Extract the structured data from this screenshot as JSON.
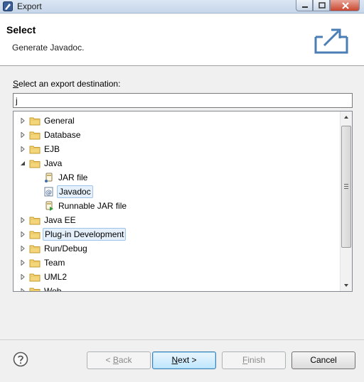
{
  "window": {
    "title": "Export",
    "icon": "eclipse-icon"
  },
  "header": {
    "title": "Select",
    "description": "Generate Javadoc.",
    "icon": "export-icon"
  },
  "destination": {
    "label_mnemonic": "S",
    "label_rest": "elect an export destination:",
    "filter_value": "j"
  },
  "tree": {
    "items": [
      {
        "label": "General",
        "level": 0,
        "type": "folder",
        "expanded": false
      },
      {
        "label": "Database",
        "level": 0,
        "type": "folder",
        "expanded": false
      },
      {
        "label": "EJB",
        "level": 0,
        "type": "folder",
        "expanded": false
      },
      {
        "label": "Java",
        "level": 0,
        "type": "folder",
        "expanded": true
      },
      {
        "label": "JAR file",
        "level": 1,
        "type": "jar",
        "expanded": null
      },
      {
        "label": "Javadoc",
        "level": 1,
        "type": "javadoc",
        "expanded": null,
        "selected": true
      },
      {
        "label": "Runnable JAR file",
        "level": 1,
        "type": "runnable-jar",
        "expanded": null
      },
      {
        "label": "Java EE",
        "level": 0,
        "type": "folder",
        "expanded": false
      },
      {
        "label": "Plug-in Development",
        "level": 0,
        "type": "folder",
        "expanded": false,
        "hover": true
      },
      {
        "label": "Run/Debug",
        "level": 0,
        "type": "folder",
        "expanded": false
      },
      {
        "label": "Team",
        "level": 0,
        "type": "folder",
        "expanded": false
      },
      {
        "label": "UML2",
        "level": 0,
        "type": "folder",
        "expanded": false
      },
      {
        "label": "Web",
        "level": 0,
        "type": "folder",
        "expanded": false
      }
    ]
  },
  "buttons": {
    "back_prefix": "< ",
    "back_mnemonic": "B",
    "back_rest": "ack",
    "next_mnemonic": "N",
    "next_rest": "ext >",
    "finish_mnemonic": "F",
    "finish_rest": "inish",
    "cancel": "Cancel"
  },
  "colors": {
    "selection_bg": "#e5f0fb",
    "selection_border": "#9cc4ea",
    "default_button_border": "#3c7fb1"
  }
}
